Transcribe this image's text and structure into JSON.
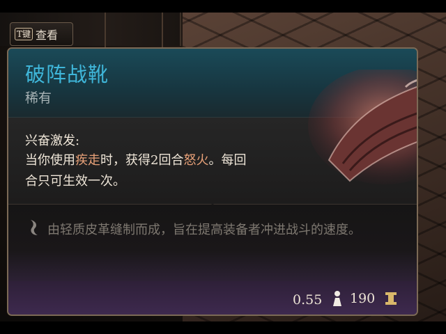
{
  "key_hint": {
    "key": "T键",
    "label": "查看"
  },
  "item": {
    "name": "破阵战靴",
    "rarity": "稀有",
    "effect_title": "兴奋激发:",
    "effect_line1_a": "当你使用",
    "effect_line1_hl1": "疾走",
    "effect_line1_b": "时，获得2回合",
    "effect_line1_hl2": "怒火",
    "effect_line1_c": "。每回",
    "effect_line2": "合只可生效一次。",
    "lore": "由轻质皮革缝制而成，旨在提高装备者冲进战斗的速度。",
    "weight": "0.55",
    "price": "190"
  },
  "icons": {
    "lore": "quill-icon",
    "weight": "weight-icon",
    "gold": "gold-coin-icon",
    "item_image": "boots-icon"
  },
  "colors": {
    "name": "#3fb6d9",
    "highlight": "#e8a178",
    "lore": "#7e7870",
    "gold": "#d9b86a"
  }
}
